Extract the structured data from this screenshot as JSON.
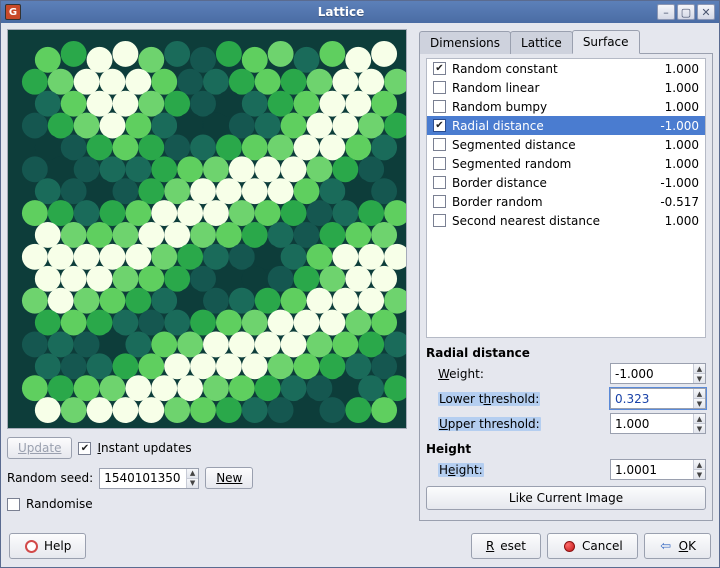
{
  "window": {
    "title": "Lattice"
  },
  "left": {
    "update_label": "Update",
    "instant_updates_label": "Instant updates",
    "instant_updates_checked": true,
    "random_seed_label": "Random seed:",
    "random_seed_value": "1540101350",
    "new_label": "New",
    "randomise_label": "Randomise",
    "randomise_checked": false
  },
  "tabs": [
    "Dimensions",
    "Lattice",
    "Surface"
  ],
  "active_tab": 2,
  "surface_list": [
    {
      "name": "Random constant",
      "checked": true,
      "value": "1.000",
      "selected": false
    },
    {
      "name": "Random linear",
      "checked": false,
      "value": "1.000",
      "selected": false
    },
    {
      "name": "Random bumpy",
      "checked": false,
      "value": "1.000",
      "selected": false
    },
    {
      "name": "Radial distance",
      "checked": true,
      "value": "-1.000",
      "selected": true
    },
    {
      "name": "Segmented distance",
      "checked": false,
      "value": "1.000",
      "selected": false
    },
    {
      "name": "Segmented random",
      "checked": false,
      "value": "1.000",
      "selected": false
    },
    {
      "name": "Border distance",
      "checked": false,
      "value": "-1.000",
      "selected": false
    },
    {
      "name": "Border random",
      "checked": false,
      "value": "-0.517",
      "selected": false
    },
    {
      "name": "Second nearest distance",
      "checked": false,
      "value": "1.000",
      "selected": false
    }
  ],
  "detail": {
    "section_title": "Radial distance",
    "weight_label": "Weight:",
    "weight_value": "-1.000",
    "lower_label": "Lower threshold:",
    "lower_value": "0.323",
    "upper_label": "Upper threshold:",
    "upper_value": "1.000",
    "height_section": "Height",
    "height_label": "Height:",
    "height_value": "1.0001",
    "like_current": "Like Current Image"
  },
  "buttons": {
    "help": "Help",
    "reset": "Reset",
    "cancel": "Cancel",
    "ok": "OK"
  }
}
